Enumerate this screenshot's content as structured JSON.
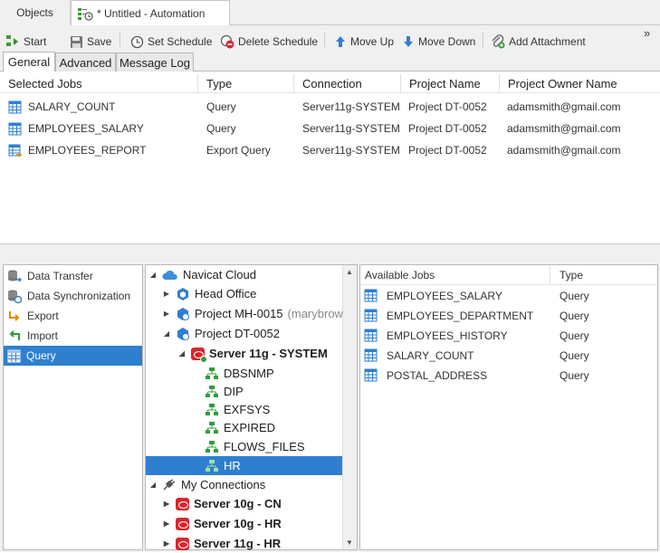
{
  "tabs": {
    "objects": "Objects",
    "automation": "* Untitled - Automation"
  },
  "toolbar": {
    "start": "Start",
    "save": "Save",
    "set_schedule": "Set Schedule",
    "delete_schedule": "Delete Schedule",
    "move_up": "Move Up",
    "move_down": "Move Down",
    "add_attachment": "Add Attachment",
    "overflow": "»"
  },
  "subtabs": {
    "general": "General",
    "advanced": "Advanced",
    "message_log": "Message Log"
  },
  "jobs_table": {
    "headers": [
      "Selected Jobs",
      "Type",
      "Connection",
      "Project Name",
      "Project Owner Name"
    ],
    "rows": [
      {
        "name": "SALARY_COUNT",
        "type": "Query",
        "connection": "Server11g-SYSTEM",
        "project": "Project DT-0052",
        "owner": "adamsmith@gmail.com"
      },
      {
        "name": "EMPLOYEES_SALARY",
        "type": "Query",
        "connection": "Server11g-SYSTEM",
        "project": "Project DT-0052",
        "owner": "adamsmith@gmail.com"
      },
      {
        "name": "EMPLOYEES_REPORT",
        "type": "Export Query",
        "connection": "Server11g-SYSTEM",
        "project": "Project DT-0052",
        "owner": "adamsmith@gmail.com"
      }
    ]
  },
  "job_types": [
    "Data Transfer",
    "Data Synchronization",
    "Export",
    "Import",
    "Query"
  ],
  "selected_job_type": "Query",
  "tree": {
    "navicat_cloud": "Navicat Cloud",
    "head_office": "Head Office",
    "project_mh": "Project MH-0015",
    "project_mh_owner": "(marybrow",
    "project_dt": "Project DT-0052",
    "server_11g_system": "Server 11g - SYSTEM",
    "schemas": [
      "DBSNMP",
      "DIP",
      "EXFSYS",
      "EXPIRED",
      "FLOWS_FILES",
      "HR"
    ],
    "my_connections": "My Connections",
    "connections": [
      "Server 10g - CN",
      "Server 10g - HR",
      "Server 11g - HR"
    ]
  },
  "available_jobs": {
    "headers": [
      "Available Jobs",
      "Type"
    ],
    "rows": [
      {
        "name": "EMPLOYEES_SALARY",
        "type": "Query"
      },
      {
        "name": "EMPLOYEES_DEPARTMENT",
        "type": "Query"
      },
      {
        "name": "EMPLOYEES_HISTORY",
        "type": "Query"
      },
      {
        "name": "SALARY_COUNT",
        "type": "Query"
      },
      {
        "name": "POSTAL_ADDRESS",
        "type": "Query"
      }
    ]
  },
  "colors": {
    "selection": "#2f7fd0",
    "oracle_red": "#d9262e",
    "schema_green": "#2e9e3a",
    "cloud_blue": "#3a8fd8"
  }
}
